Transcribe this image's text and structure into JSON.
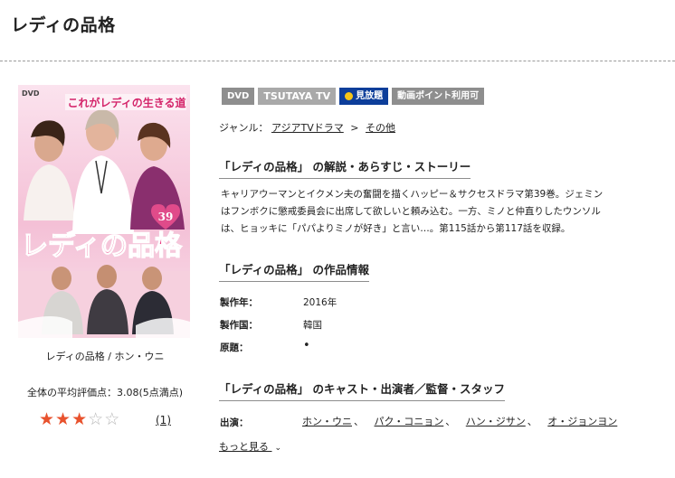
{
  "page": {
    "title": "レディの品格"
  },
  "cover": {
    "format_label": "DVD",
    "tagline": "これがレディの生きる道",
    "logo": "レディの品格",
    "volume": "39"
  },
  "item": {
    "caption": "レディの品格 / ホン・ウニ",
    "rating_label": "全体の平均評価点：3.08(5点満点)",
    "rating_value": 3.08,
    "rating_max": 5,
    "stars_filled": 3,
    "rating_count": "(1)"
  },
  "badges": [
    "DVD",
    "TSUTAYA TV",
    "見放題",
    "動画ポイント利用可"
  ],
  "genre": {
    "prefix": "ジャンル：",
    "items": [
      "アジアTVドラマ",
      "その他"
    ],
    "separator": ">"
  },
  "sections": {
    "synopsis_heading": "「レディの品格」 の解説・あらすじ・ストーリー",
    "synopsis_lines": [
      "キャリアウーマンとイクメン夫の奮闘を描くハッピー＆サクセスドラマ第39巻。ジェミン",
      "はフンボクに懲戒委員会に出席して欲しいと頼み込む。一方、ミノと仲直りしたウンソル",
      "は、ヒョッキに「パパよりミノが好き」と言い…。第115話から第117話を収録。"
    ],
    "info_heading": "「レディの品格」 の作品情報",
    "info_rows": [
      {
        "label": "製作年：",
        "value": "2016年"
      },
      {
        "label": "製作国：",
        "value": "韓国"
      },
      {
        "label": "原題：",
        "value": "•"
      }
    ],
    "cast_heading": "「レディの品格」 のキャスト・出演者／監督・スタッフ",
    "cast_label": "出演：",
    "cast": [
      "ホン・ウニ",
      "パク・コニョン",
      "ハン・ジサン",
      "オ・ジョンヨン"
    ],
    "cast_separator": "、",
    "more_label": "もっと見る"
  },
  "colors": {
    "star_on": "#e8522d",
    "star_off": "#b8b8b8",
    "badge_gray": "#8e8e8e",
    "badge_blue": "#0d3e9a",
    "cover_pink": "#f2b9d0"
  }
}
